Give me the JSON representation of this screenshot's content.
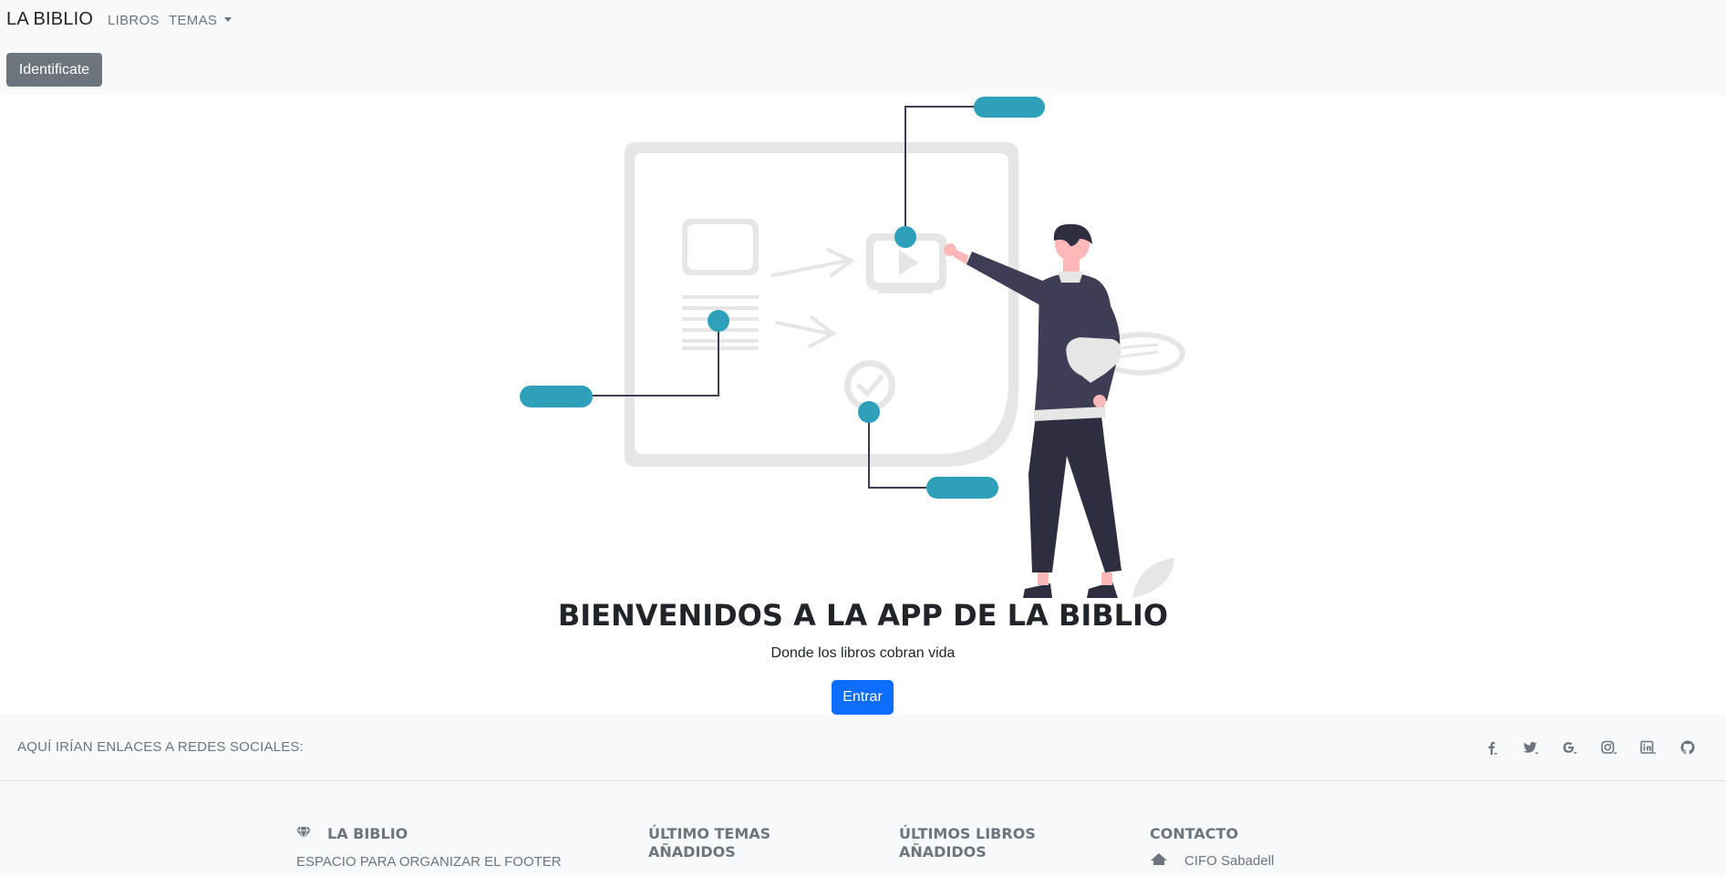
{
  "navbar": {
    "brand": "LA BIBLIO",
    "links": [
      "LIBROS",
      "TEMAS"
    ],
    "login_button": "Identificate"
  },
  "hero": {
    "title": "BIENVENIDOS A LA APP DE LA BIBLIO",
    "subtitle": "Donde los libros cobran vida",
    "cta_button": "Entrar",
    "accent_color": "#2ea0b9"
  },
  "social": {
    "text": "AQUÍ IRÍAN ENLACES A REDES SOCIALES:",
    "icons": [
      "facebook-icon",
      "twitter-icon",
      "google-icon",
      "instagram-icon",
      "linkedin-icon",
      "github-icon"
    ]
  },
  "footer": {
    "brand": "LA BIBLIO",
    "brand_text": "ESPACIO PARA ORGANIZAR EL FOOTER",
    "col2_title": "ÚLTIMO TEMAS AÑADIDOS",
    "col3_title": "ÚLTIMOS LIBROS AÑADIDOS",
    "col4_title": "CONTACTO",
    "contact_address": "CIFO Sabadell"
  }
}
